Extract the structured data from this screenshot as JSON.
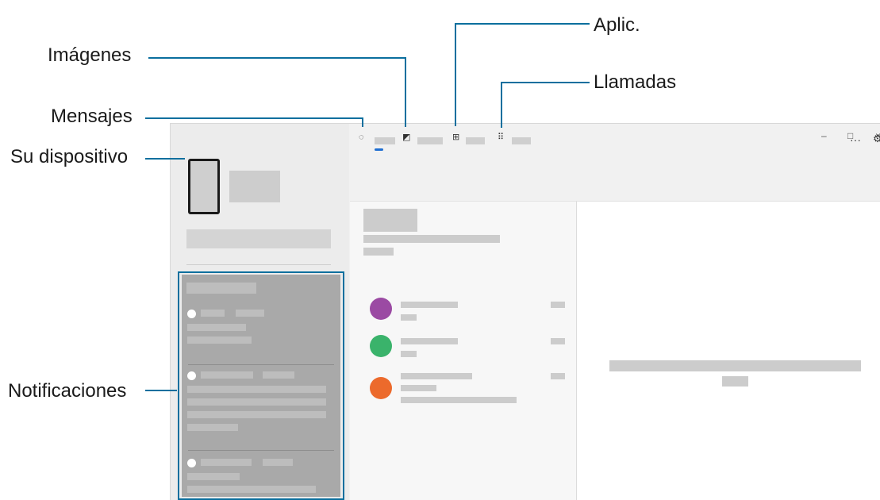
{
  "callouts": {
    "aplic": "Aplic.",
    "imagenes": "Imágenes",
    "llamadas": "Llamadas",
    "mensajes": "Mensajes",
    "su_dispositivo": "Su dispositivo",
    "notificaciones": "Notificaciones"
  },
  "window": {
    "minimize": "–",
    "maximize": "□",
    "close": "×",
    "more": "···",
    "settings": "⚙"
  },
  "tabs": [
    {
      "icon": "message-icon",
      "glyph": "◌"
    },
    {
      "icon": "image-icon",
      "glyph": "◩"
    },
    {
      "icon": "apps-icon",
      "glyph": "⊞"
    },
    {
      "icon": "dialpad-icon",
      "glyph": "⠿"
    }
  ],
  "conversations": [
    {
      "avatar_color": "#9b4aa3"
    },
    {
      "avatar_color": "#3ab36b"
    },
    {
      "avatar_color": "#ec6a2c"
    }
  ],
  "colors": {
    "callout_line": "#0a6f9e",
    "accent": "#1f6fd1"
  }
}
